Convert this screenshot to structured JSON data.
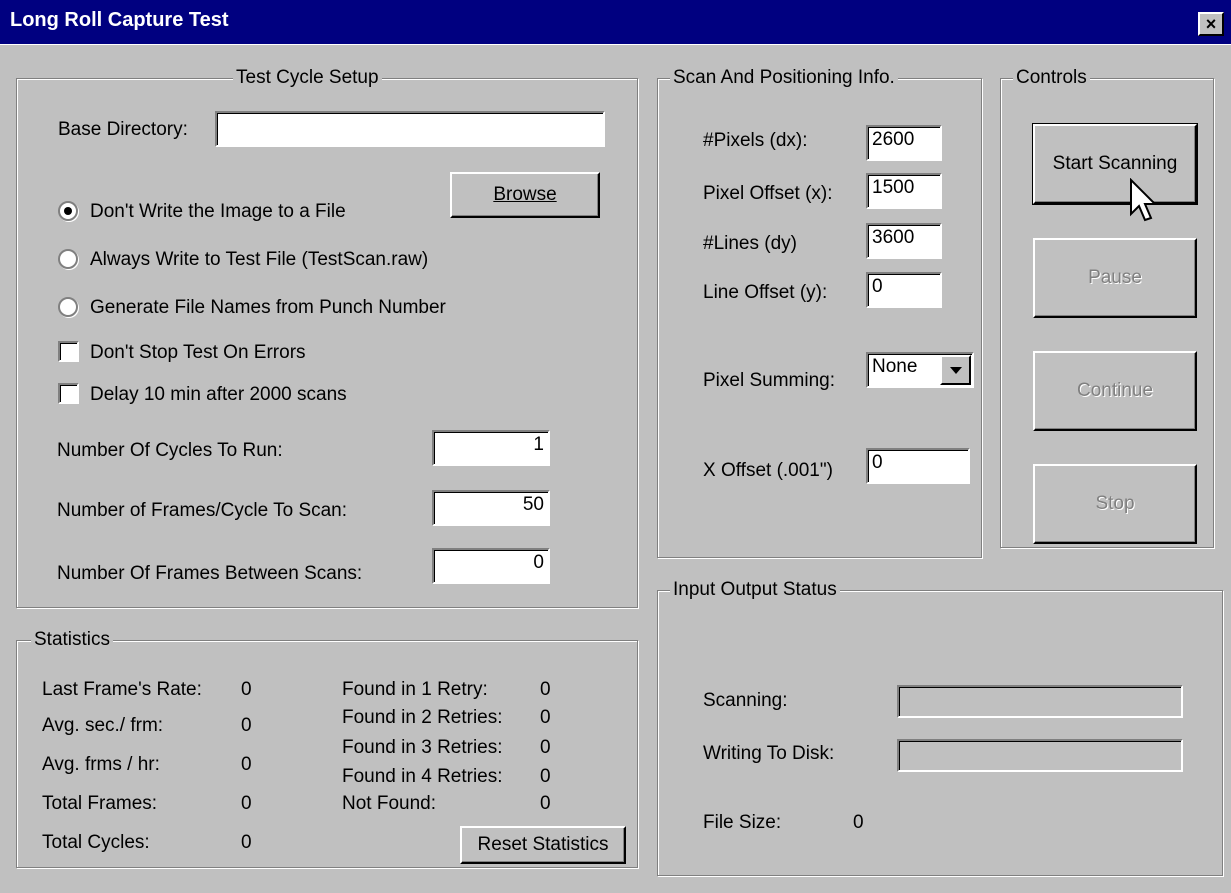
{
  "window": {
    "title": "Long Roll Capture Test",
    "close_label": "×"
  },
  "test_cycle_setup": {
    "legend": "Test Cycle Setup",
    "base_directory_label": "Base Directory:",
    "base_directory_value": "",
    "browse_label": "Browse",
    "radio_dont_write": "Don't Write the Image to a File",
    "radio_always_write": "Always Write to Test File  (TestScan.raw)",
    "radio_generate_names": "Generate File Names from Punch Number",
    "check_dont_stop": "Don't Stop Test On Errors",
    "check_delay": "Delay 10 min after 2000 scans",
    "cycles_label": "Number Of Cycles To Run:",
    "cycles_value": "1",
    "frames_label": "Number of Frames/Cycle To Scan:",
    "frames_value": "50",
    "between_label": "Number Of Frames Between Scans:",
    "between_value": "0"
  },
  "scan_info": {
    "legend": "Scan And Positioning Info.",
    "pixels_label": "#Pixels (dx):",
    "pixels_value": "2600",
    "pixel_offset_label": "Pixel Offset (x):",
    "pixel_offset_value": "1500",
    "lines_label": "#Lines  (dy)",
    "lines_value": "3600",
    "line_offset_label": "Line Offset (y):",
    "line_offset_value": "0",
    "summing_label": "Pixel Summing:",
    "summing_value": "None",
    "x_offset_label": "X Offset (.001\")",
    "x_offset_value": "0"
  },
  "controls": {
    "legend": "Controls",
    "start_label": "Start Scanning",
    "pause_label": "Pause",
    "continue_label": "Continue",
    "stop_label": "Stop"
  },
  "statistics": {
    "legend": "Statistics",
    "last_rate_label": "Last Frame's Rate:",
    "last_rate_value": "0",
    "avg_sec_label": "Avg. sec./ frm:",
    "avg_sec_value": "0",
    "avg_frms_label": "Avg. frms / hr:",
    "avg_frms_value": "0",
    "total_frames_label": "Total Frames:",
    "total_frames_value": "0",
    "total_cycles_label": "Total Cycles:",
    "total_cycles_value": "0",
    "retry1_label": "Found in 1 Retry:",
    "retry1_value": "0",
    "retry2_label": "Found in 2 Retries:",
    "retry2_value": "0",
    "retry3_label": "Found in 3 Retries:",
    "retry3_value": "0",
    "retry4_label": "Found in 4 Retries:",
    "retry4_value": "0",
    "not_found_label": "Not Found:",
    "not_found_value": "0",
    "reset_label": "Reset Statistics"
  },
  "io_status": {
    "legend": "Input Output Status",
    "scanning_label": "Scanning:",
    "writing_label": "Writing To Disk:",
    "file_size_label": "File Size:",
    "file_size_value": "0"
  }
}
